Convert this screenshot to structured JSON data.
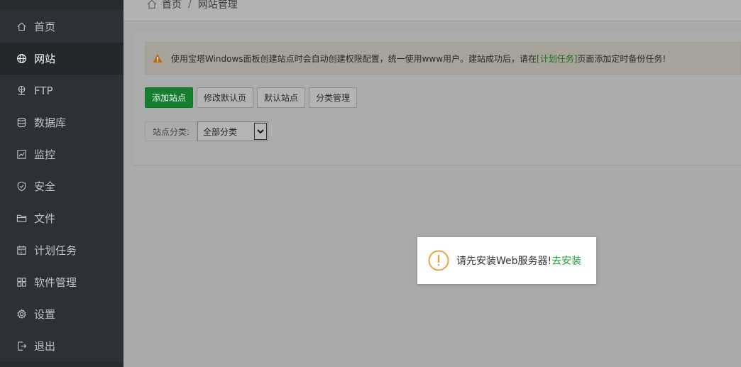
{
  "sidebar": {
    "items": [
      {
        "label": "首页",
        "icon": "home-icon",
        "active": false
      },
      {
        "label": "网站",
        "icon": "globe-icon",
        "active": true
      },
      {
        "label": "FTP",
        "icon": "ftp-icon",
        "active": false
      },
      {
        "label": "数据库",
        "icon": "database-icon",
        "active": false
      },
      {
        "label": "监控",
        "icon": "monitor-icon",
        "active": false
      },
      {
        "label": "安全",
        "icon": "shield-icon",
        "active": false
      },
      {
        "label": "文件",
        "icon": "folder-icon",
        "active": false
      },
      {
        "label": "计划任务",
        "icon": "calendar-icon",
        "active": false
      },
      {
        "label": "软件管理",
        "icon": "apps-grid-icon",
        "active": false
      },
      {
        "label": "设置",
        "icon": "gear-icon",
        "active": false
      },
      {
        "label": "退出",
        "icon": "logout-icon",
        "active": false
      }
    ]
  },
  "breadcrumb": {
    "home": "首页",
    "separator": "/",
    "current": "网站管理"
  },
  "alert": {
    "text_before": "使用宝塔Windows面板创建站点时会自动创建权限配置，统一使用www用户。建站成功后，请在",
    "link": "[计划任务]",
    "text_after": "页面添加定时备份任务!"
  },
  "toolbar": {
    "add_site": "添加站点",
    "edit_default_page": "修改默认页",
    "default_site": "默认站点",
    "category_manage": "分类管理"
  },
  "filter": {
    "label": "站点分类:",
    "selected": "全部分类"
  },
  "dialog": {
    "message": "请先安装Web服务器!",
    "link": "去安装"
  },
  "colors": {
    "sidebar_bg": "#2c3137",
    "primary_green": "#167f2f",
    "link_green": "#20a53a",
    "warning_orange": "#e8a33d"
  }
}
